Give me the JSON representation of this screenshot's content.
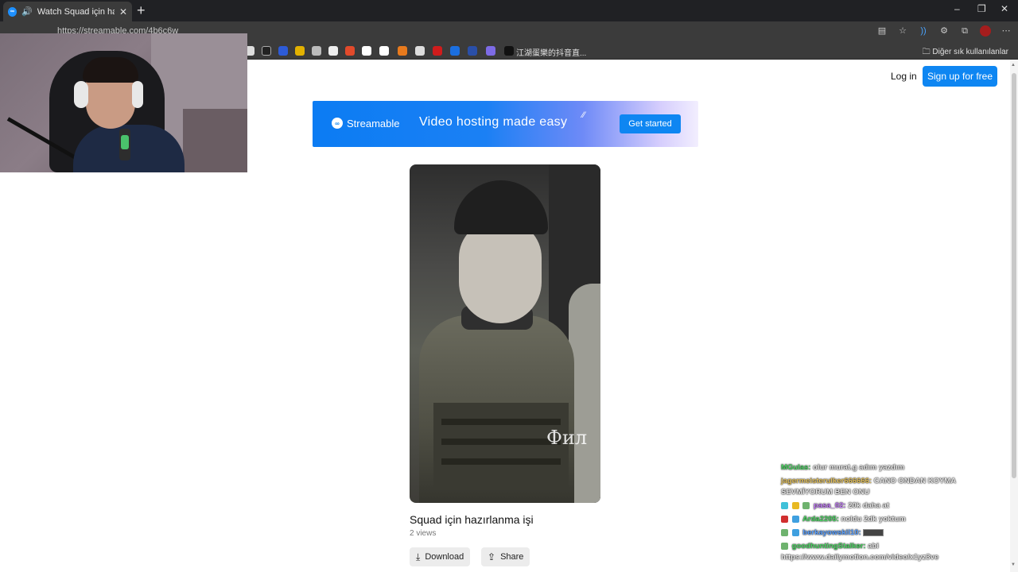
{
  "browser": {
    "tab_title": "Watch Squad için hazırlanma",
    "tab_favicon": "streamable-icon",
    "url": "https://streamable.com/4b6c6w",
    "bookmark_label": "江湖蛋樂的抖音直...",
    "bookmarks_folder": "Diğer sık kullanılanlar",
    "window_controls": [
      "–",
      "❐",
      "✕"
    ]
  },
  "header": {
    "login": "Log in",
    "signup": "Sign up for free"
  },
  "banner": {
    "brand": "Streamable",
    "headline": "Video hosting made easy",
    "cta": "Get started",
    "accent_color": "#0e86f2"
  },
  "video": {
    "title": "Squad için hazırlanma işi",
    "views": "2 views",
    "overlay_text": "Фил"
  },
  "actions": {
    "download": "Download",
    "share": "Share"
  },
  "chat": [
    {
      "name": "MGulas:",
      "name_color": "#4cd964",
      "msg": "olur murat.g adım yazdım"
    },
    {
      "name": "jagermeisterulker666666:",
      "name_color": "#e6c35c",
      "msg": "CANO ONDAN KOYMA SEVMİYORUM BEN ONU"
    },
    {
      "name": "pasa_02:",
      "name_color": "#c77dff",
      "msg": "20k daha at"
    },
    {
      "name": "Arda2205:",
      "name_color": "#4cd964",
      "msg": "noldu 2dk yoktum"
    },
    {
      "name": "berkayowskil10:",
      "name_color": "#5aa0ff",
      "msg": ""
    },
    {
      "name": "goodhuntingStalker:",
      "name_color": "#4cd964",
      "msg": "abi https://www.dailymotion.com/video/x1yz3ve"
    }
  ]
}
